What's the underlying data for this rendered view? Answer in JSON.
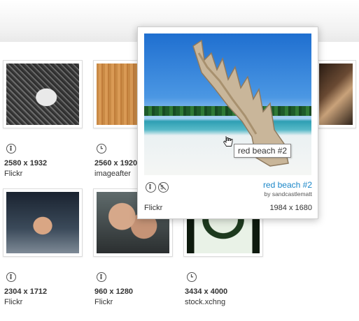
{
  "grid": {
    "row1": [
      {
        "dims": "2580 x 1932",
        "source": "Flickr",
        "license_icon": "attribution-icon"
      },
      {
        "dims": "2560 x 1920",
        "source": "imageafter",
        "license_icon": "clock-icon"
      },
      {
        "dims": "",
        "source": "",
        "license_icon": ""
      }
    ],
    "row2": [
      {
        "dims": "2304 x 1712",
        "source": "Flickr",
        "license_icon": "attribution-icon"
      },
      {
        "dims": "960 x 1280",
        "source": "Flickr",
        "license_icon": "attribution-icon"
      },
      {
        "dims": "3434 x 4000",
        "source": "stock.xchng",
        "license_icon": "clock-icon"
      }
    ]
  },
  "popup": {
    "title": "red beach #2",
    "author": "by sandcastlematt",
    "source": "Flickr",
    "dims": "1984 x 1680",
    "tooltip": "red beach #2",
    "license_icons": [
      "attribution-icon",
      "noncommercial-icon"
    ]
  },
  "colors": {
    "link": "#1a86c8",
    "border": "#dcdcdc"
  }
}
